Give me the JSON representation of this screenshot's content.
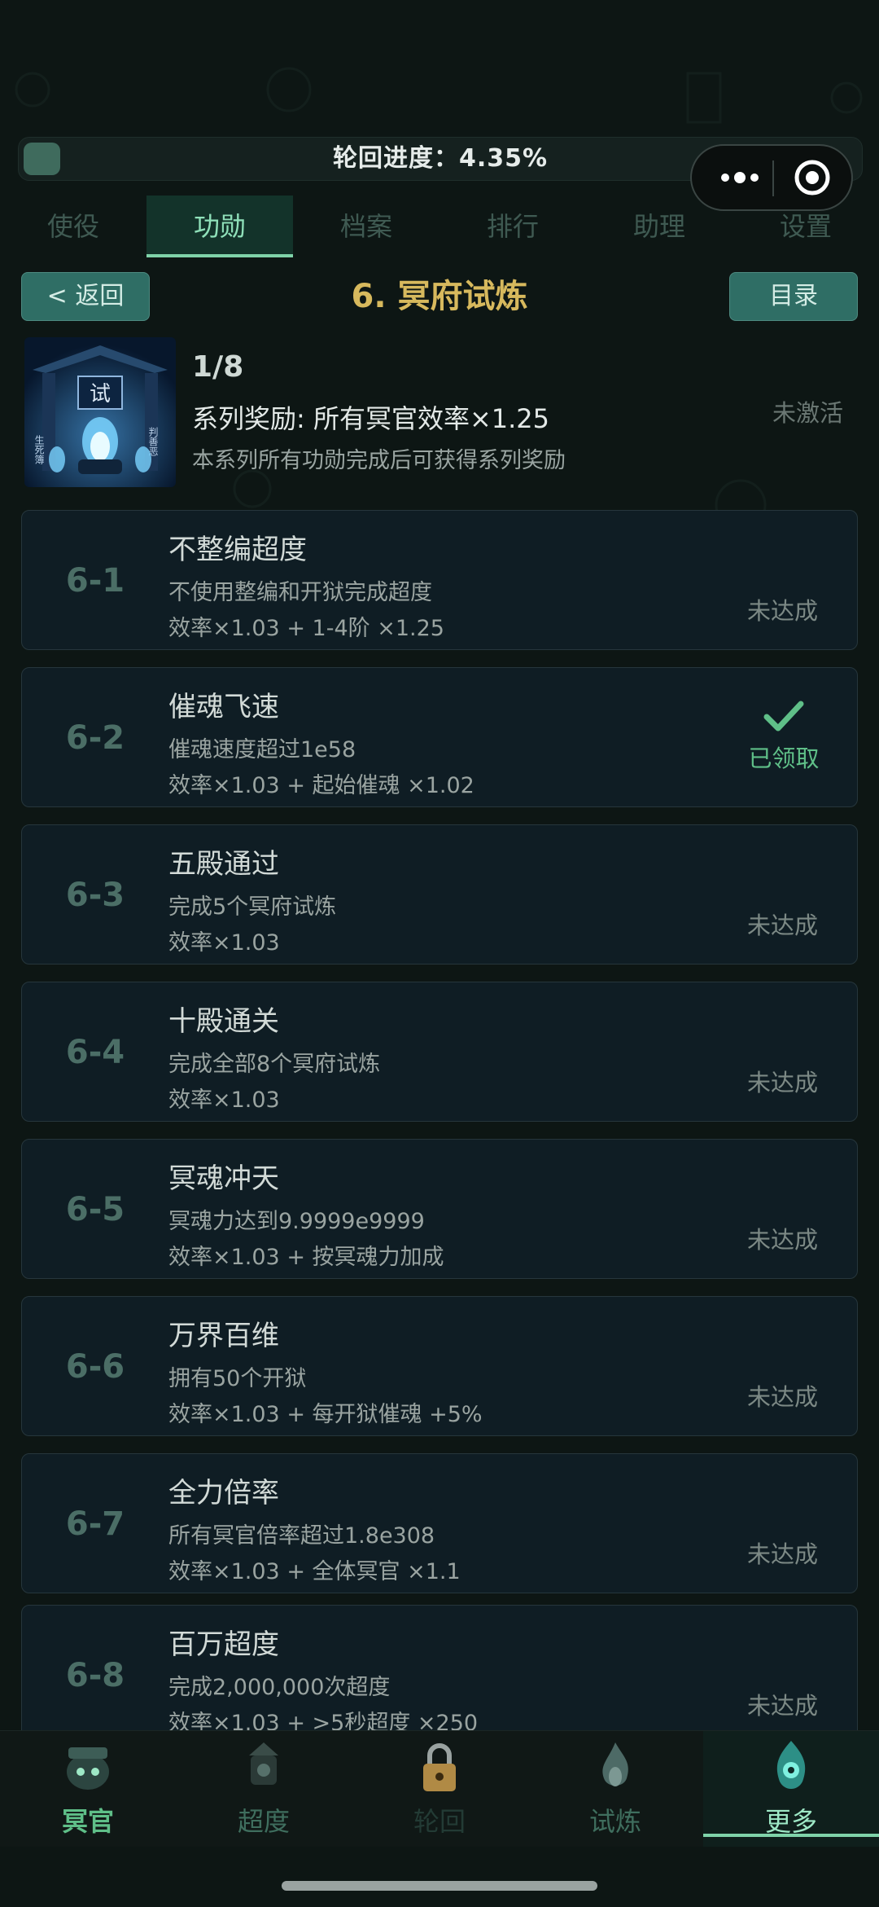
{
  "progress": {
    "label": "轮回进度：4.35%",
    "fraction": 0.0435
  },
  "tabs": [
    {
      "label": "使役"
    },
    {
      "label": "功勋"
    },
    {
      "label": "档案"
    },
    {
      "label": "排行"
    },
    {
      "label": "助理"
    },
    {
      "label": "设置"
    }
  ],
  "header": {
    "back_label": "< 返回",
    "title": "6. 冥府试炼",
    "menu_label": "目录"
  },
  "series": {
    "count": "1/8",
    "reward": "系列奖励: 所有冥官效率×1.25",
    "desc": "本系列所有功勋完成后可获得系列奖励",
    "status": "未激活",
    "image_text": {
      "center": "试",
      "left": "生死簿",
      "right": "判善恶"
    }
  },
  "achievements": [
    {
      "num": "6-1",
      "name": "不整编超度",
      "req": "不使用整编和开狱完成超度",
      "reward": "效率×1.03 + 1-4阶 ×1.25",
      "status": "未达成",
      "claimed": false
    },
    {
      "num": "6-2",
      "name": "催魂飞速",
      "req": "催魂速度超过1e58",
      "reward": "效率×1.03 + 起始催魂 ×1.02",
      "status": "已领取",
      "claimed": true
    },
    {
      "num": "6-3",
      "name": "五殿通过",
      "req": "完成5个冥府试炼",
      "reward": "效率×1.03",
      "status": "未达成",
      "claimed": false
    },
    {
      "num": "6-4",
      "name": "十殿通关",
      "req": "完成全部8个冥府试炼",
      "reward": "效率×1.03",
      "status": "未达成",
      "claimed": false
    },
    {
      "num": "6-5",
      "name": "冥魂冲天",
      "req": "冥魂力达到9.9999e9999",
      "reward": "效率×1.03 + 按冥魂力加成",
      "status": "未达成",
      "claimed": false
    },
    {
      "num": "6-6",
      "name": "万界百维",
      "req": "拥有50个开狱",
      "reward": "效率×1.03 + 每开狱催魂 +5%",
      "status": "未达成",
      "claimed": false
    },
    {
      "num": "6-7",
      "name": "全力倍率",
      "req": "所有冥官倍率超过1.8e308",
      "reward": "效率×1.03 + 全体冥官 ×1.1",
      "status": "未达成",
      "claimed": false
    },
    {
      "num": "6-8",
      "name": "百万超度",
      "req": "完成2,000,000次超度",
      "reward": "效率×1.03 + >5秒超度 ×250",
      "status": "未达成",
      "claimed": false
    }
  ],
  "nav": [
    {
      "label": "冥官",
      "color": "#5fbf88"
    },
    {
      "label": "超度",
      "color": "#3f6e5e"
    },
    {
      "label": "轮回",
      "color": "#233b35"
    },
    {
      "label": "试炼",
      "color": "#3f6e5e"
    },
    {
      "label": "更多",
      "color": "#9ee8c6"
    }
  ],
  "colors": {
    "accent": "#7fd3a9",
    "title": "#d7b95d",
    "claimed": "#5fbf88"
  }
}
